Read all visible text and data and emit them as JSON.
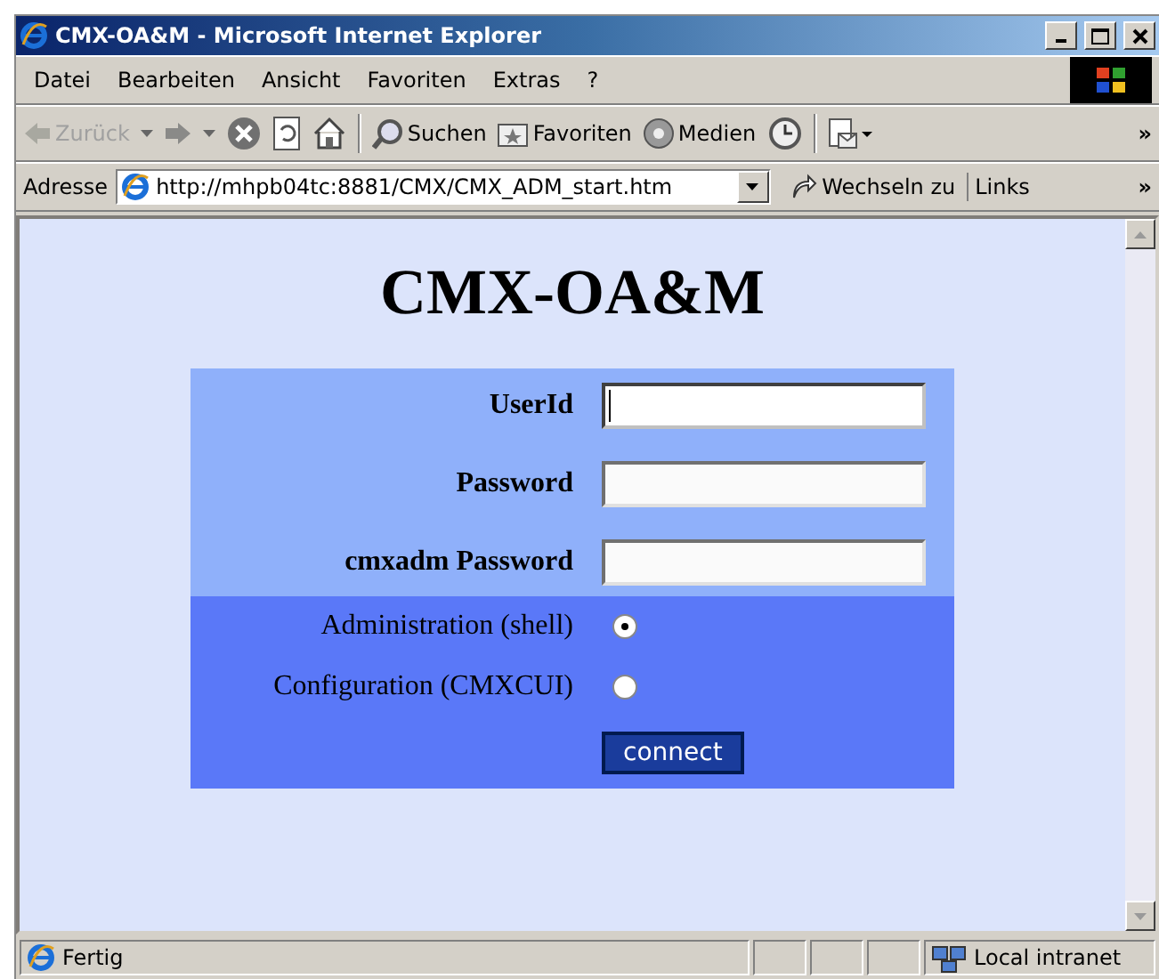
{
  "window": {
    "title": "CMX-OA&M - Microsoft Internet Explorer"
  },
  "menu": [
    "Datei",
    "Bearbeiten",
    "Ansicht",
    "Favoriten",
    "Extras",
    "?"
  ],
  "toolbar": [
    {
      "kind": "back",
      "label": "Zurück",
      "disabled": true
    },
    {
      "kind": "forward",
      "disabled": false
    },
    {
      "kind": "stop"
    },
    {
      "kind": "refresh"
    },
    {
      "kind": "home"
    },
    {
      "kind": "search",
      "label": "Suchen"
    },
    {
      "kind": "favorites",
      "label": "Favoriten"
    },
    {
      "kind": "media",
      "label": "Medien"
    },
    {
      "kind": "history"
    },
    {
      "kind": "mail"
    }
  ],
  "toolbar_more": "»",
  "address": {
    "label": "Adresse",
    "value": "http://mhpb04tc:8881/CMX/CMX_ADM_start.htm",
    "go": "Wechseln zu",
    "links": "Links",
    "more": "»"
  },
  "page": {
    "heading": "CMX-OA&M",
    "fields": [
      {
        "label": "UserId",
        "focused": true
      },
      {
        "label": "Password",
        "focused": false
      },
      {
        "label": "cmxadm Password",
        "focused": false
      }
    ],
    "options": [
      {
        "label": "Administration (shell)",
        "selected": true
      },
      {
        "label": "Configuration (CMXCUI)",
        "selected": false
      }
    ],
    "button": "connect"
  },
  "status_bar": {
    "text": "Fertig",
    "zone": "Local intranet"
  }
}
